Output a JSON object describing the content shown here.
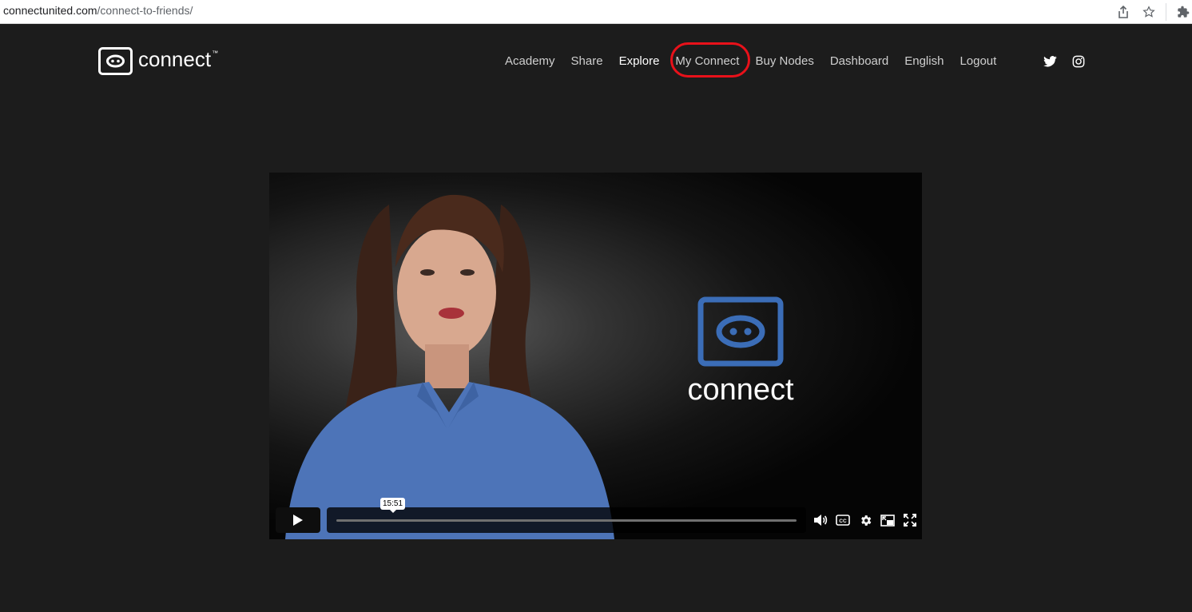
{
  "browser": {
    "url_domain": "connectunited.com",
    "url_path": "/connect-to-friends/",
    "icons": [
      "share-icon",
      "star-icon",
      "extensions-icon"
    ]
  },
  "header": {
    "logo_text": "connect",
    "logo_tm": "™",
    "nav": [
      {
        "label": "Academy",
        "active": false
      },
      {
        "label": "Share",
        "active": false
      },
      {
        "label": "Explore",
        "active": true
      },
      {
        "label": "My Connect",
        "active": false,
        "highlighted": true
      },
      {
        "label": "Buy Nodes",
        "active": false
      },
      {
        "label": "Dashboard",
        "active": false
      },
      {
        "label": "English",
        "active": false
      },
      {
        "label": "Logout",
        "active": false
      }
    ],
    "social_icons": [
      "twitter-icon",
      "instagram-icon"
    ],
    "highlight_color": "#e8111a"
  },
  "video": {
    "brand_text": "connect",
    "brand_color": "#3b6db7",
    "time_tooltip": "15:51",
    "progress": 0,
    "controls": [
      "play-icon",
      "volume-icon",
      "captions-icon",
      "settings-icon",
      "picture-in-picture-icon",
      "fullscreen-icon"
    ]
  }
}
